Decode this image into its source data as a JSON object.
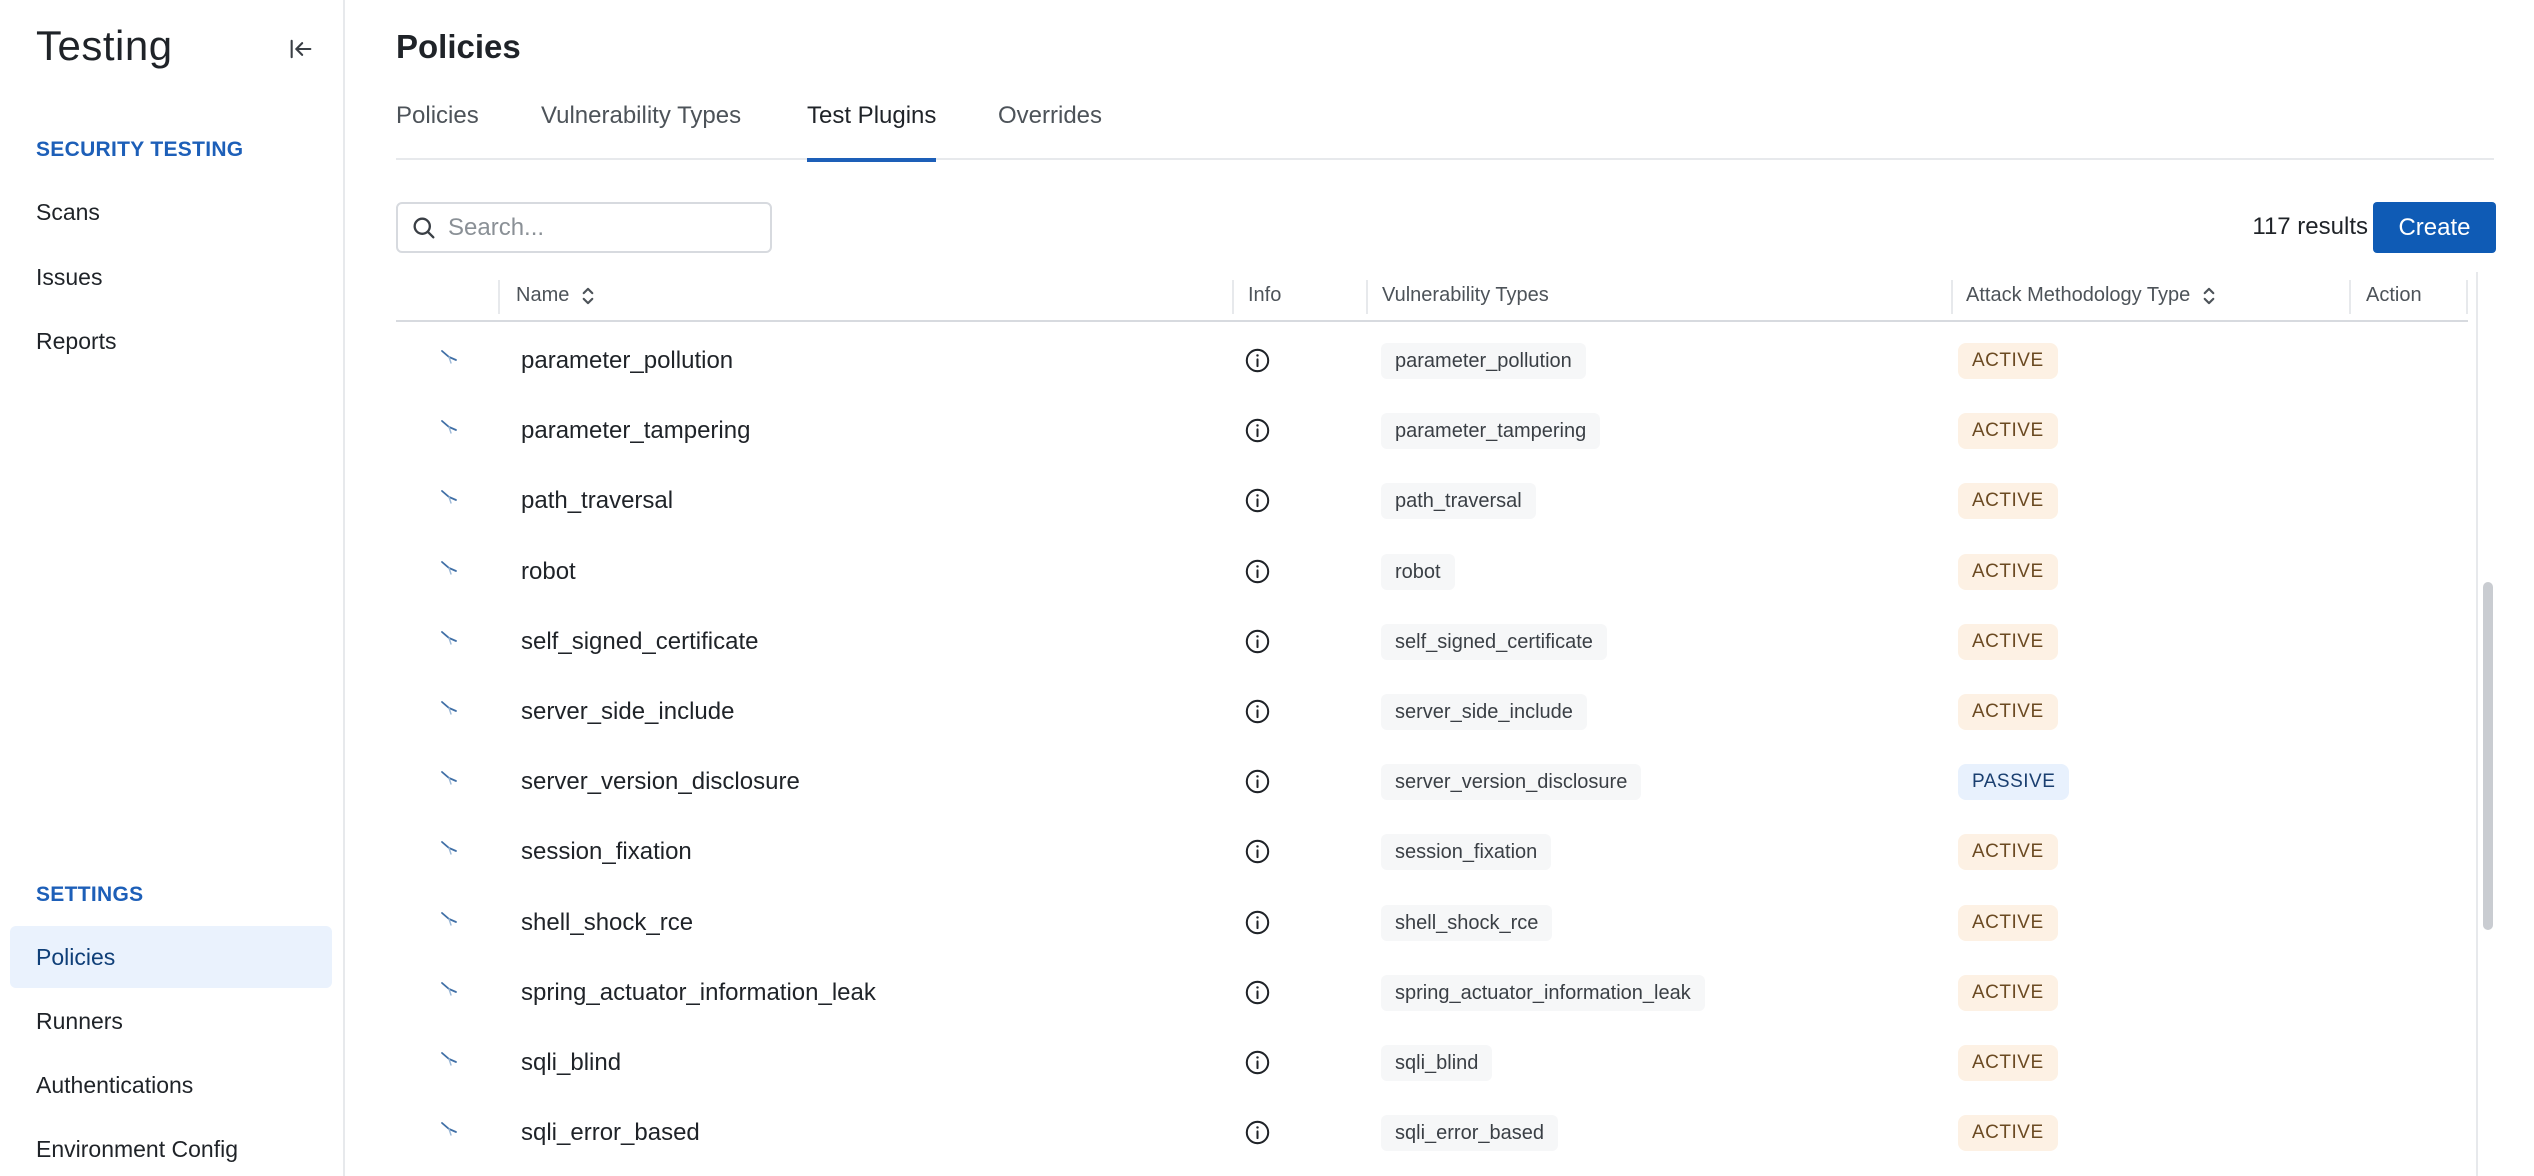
{
  "app": {
    "title": "Testing"
  },
  "sidebar": {
    "security_section": "SECURITY TESTING",
    "security_items": [
      {
        "label": "Scans"
      },
      {
        "label": "Issues"
      },
      {
        "label": "Reports"
      }
    ],
    "settings_section": "SETTINGS",
    "settings_items": [
      {
        "label": "Policies",
        "active": true
      },
      {
        "label": "Runners"
      },
      {
        "label": "Authentications"
      },
      {
        "label": "Environment Config"
      }
    ]
  },
  "page": {
    "title": "Policies"
  },
  "tabs": [
    {
      "label": "Policies"
    },
    {
      "label": "Vulnerability Types"
    },
    {
      "label": "Test Plugins",
      "active": true
    },
    {
      "label": "Overrides"
    }
  ],
  "toolbar": {
    "search_placeholder": "Search...",
    "results_text": "117 results",
    "create_label": "Create"
  },
  "table": {
    "columns": {
      "name": "Name",
      "info": "Info",
      "vulnerability_types": "Vulnerability Types",
      "attack_methodology_type": "Attack Methodology Type",
      "action": "Action"
    },
    "rows": [
      {
        "name": "parameter_pollution",
        "vuln_type": "parameter_pollution",
        "method": "ACTIVE"
      },
      {
        "name": "parameter_tampering",
        "vuln_type": "parameter_tampering",
        "method": "ACTIVE"
      },
      {
        "name": "path_traversal",
        "vuln_type": "path_traversal",
        "method": "ACTIVE"
      },
      {
        "name": "robot",
        "vuln_type": "robot",
        "method": "ACTIVE"
      },
      {
        "name": "self_signed_certificate",
        "vuln_type": "self_signed_certificate",
        "method": "ACTIVE"
      },
      {
        "name": "server_side_include",
        "vuln_type": "server_side_include",
        "method": "ACTIVE"
      },
      {
        "name": "server_version_disclosure",
        "vuln_type": "server_version_disclosure",
        "method": "PASSIVE"
      },
      {
        "name": "session_fixation",
        "vuln_type": "session_fixation",
        "method": "ACTIVE"
      },
      {
        "name": "shell_shock_rce",
        "vuln_type": "shell_shock_rce",
        "method": "ACTIVE"
      },
      {
        "name": "spring_actuator_information_leak",
        "vuln_type": "spring_actuator_information_leak",
        "method": "ACTIVE"
      },
      {
        "name": "sqli_blind",
        "vuln_type": "sqli_blind",
        "method": "ACTIVE"
      },
      {
        "name": "sqli_error_based",
        "vuln_type": "sqli_error_based",
        "method": "ACTIVE"
      }
    ]
  },
  "colors": {
    "accent": "#0f5bb5",
    "section_label": "#1d5fb8",
    "active_badge_bg": "#fdf1e4",
    "passive_badge_bg": "#e8f1fd"
  }
}
